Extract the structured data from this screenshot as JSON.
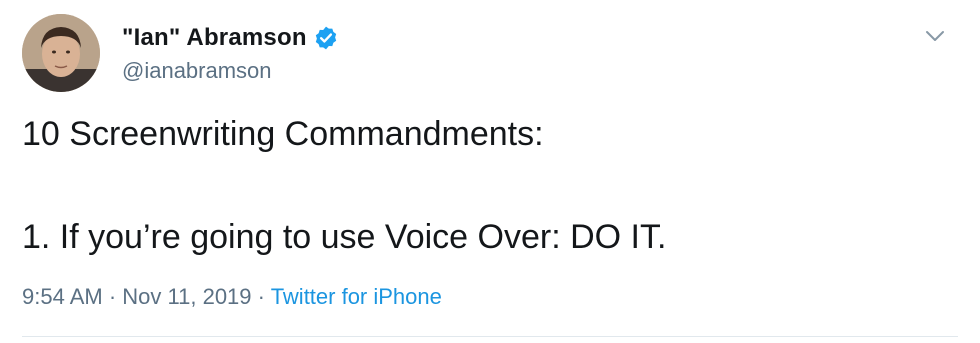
{
  "author": {
    "display_name": "\"Ian\" Abramson",
    "handle": "@ianabramson",
    "verified": true
  },
  "tweet": {
    "lines": [
      "10 Screenwriting Commandments:",
      "1.  If you’re going to use Voice Over: DO IT."
    ]
  },
  "meta": {
    "time": "9:54 AM",
    "separator_1": " · ",
    "date": "Nov 11, 2019",
    "separator_2": " · ",
    "source": "Twitter for iPhone"
  },
  "colors": {
    "text": "#14171a",
    "secondary": "#5b7083",
    "link": "#1b95e0",
    "verified_badge": "#1da1f2"
  },
  "icons": {
    "menu": "chevron-down-icon",
    "badge": "verified-badge-icon"
  }
}
